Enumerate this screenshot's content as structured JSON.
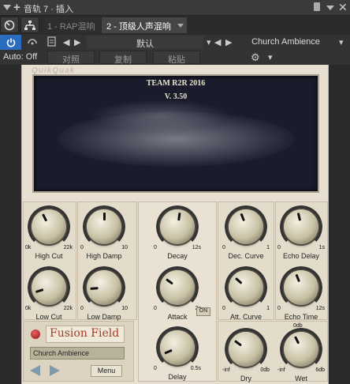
{
  "window": {
    "title": "音轨 7 · 插入"
  },
  "tabs": [
    {
      "label": "1 - RAP混响",
      "active": false
    },
    {
      "label": "2 - 顶级人声混响",
      "active": true
    }
  ],
  "toolbar": {
    "automation": "Auto: Off",
    "compare": "对照",
    "copy": "复制",
    "paste": "粘贴",
    "preset": "默认",
    "factory_preset": "Church Ambience"
  },
  "display": {
    "line1": "TEAM R2R 2016",
    "line2": "V. 3.50",
    "brand": "QuikQuak"
  },
  "knobs": [
    {
      "id": "high-cut",
      "label": "High Cut",
      "min": "0k",
      "max": "22k",
      "value": 0.4
    },
    {
      "id": "high-damp",
      "label": "High Damp",
      "min": "0",
      "max": "10",
      "value": 0.5
    },
    {
      "id": "decay",
      "label": "Decay",
      "min": "0",
      "max": "12s",
      "value": 0.53
    },
    {
      "id": "dec-curve",
      "label": "Dec. Curve",
      "min": "0",
      "max": "1",
      "value": 0.42
    },
    {
      "id": "echo-delay",
      "label": "Echo Delay",
      "min": "0",
      "max": "1s",
      "value": 0.45
    },
    {
      "id": "low-cut",
      "label": "Low Cut",
      "min": "0k",
      "max": "22k",
      "value": 0.1
    },
    {
      "id": "low-damp",
      "label": "Low Damp",
      "min": "0",
      "max": "10",
      "value": 0.15
    },
    {
      "id": "attack",
      "label": "Attack",
      "min": "0",
      "max": "2s",
      "value": 0.3
    },
    {
      "id": "att-curve",
      "label": "Att. Curve",
      "min": "0",
      "max": "1",
      "value": 0.32
    },
    {
      "id": "echo-time",
      "label": "Echo Time",
      "min": "0",
      "max": "12s",
      "value": 0.42
    },
    {
      "id": "delay",
      "label": "Delay",
      "min": "0",
      "max": "0.5s",
      "value": 0.08
    },
    {
      "id": "dry",
      "label": "Dry",
      "min": "-inf",
      "max": "0db",
      "value": 0.3
    },
    {
      "id": "wet",
      "label": "Wet",
      "min": "-inf",
      "max": "6db",
      "value": 0.4
    }
  ],
  "wet_top_label": "0db",
  "fusion": {
    "title": "Fusion Field",
    "preset": "Church Ambience",
    "menu": "Menu"
  },
  "on_label": "ON"
}
